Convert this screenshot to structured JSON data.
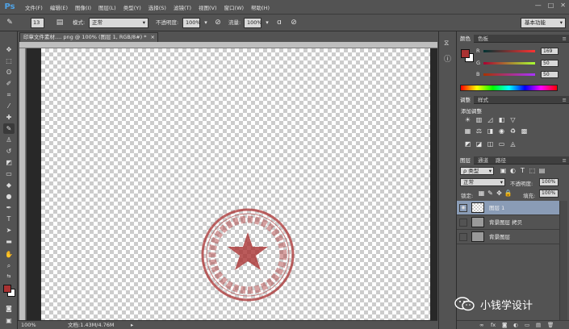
{
  "app": {
    "logo": "Ps"
  },
  "menu": [
    "文件(F)",
    "编辑(E)",
    "图像(I)",
    "图层(L)",
    "类型(Y)",
    "选择(S)",
    "滤镜(T)",
    "视图(V)",
    "窗口(W)",
    "帮助(H)"
  ],
  "options": {
    "brush_size": "13",
    "mode_label": "模式:",
    "mode_value": "正常",
    "opacity_label": "不透明度:",
    "opacity_value": "100%",
    "flow_label": "流量:",
    "flow_value": "100%",
    "workspace": "基本功能"
  },
  "document": {
    "tab_title": "印章文件素材.... png @ 100% (图层 1, RGB/8#) *",
    "zoom": "100%",
    "doc_info": "文档:1.43M/4.76M"
  },
  "color_panel": {
    "tabs": [
      "颜色",
      "色板"
    ],
    "channels": [
      {
        "label": "R",
        "value": "169"
      },
      {
        "label": "G",
        "value": "50"
      },
      {
        "label": "B",
        "value": "50"
      }
    ],
    "foreground": "#a93232",
    "background": "#ffffff"
  },
  "adjust_panel": {
    "tabs": [
      "调整",
      "样式"
    ],
    "title": "添加调整"
  },
  "layers_panel": {
    "tabs": [
      "图层",
      "通道",
      "路径"
    ],
    "filter_label": "ρ 类型",
    "blend_mode": "正常",
    "opacity_label": "不透明度:",
    "opacity_value": "100%",
    "lock_label": "锁定:",
    "fill_label": "填充:",
    "fill_value": "100%",
    "layers": [
      {
        "name": "图层 1",
        "selected": true,
        "visible": true
      },
      {
        "name": "背景图层 拷贝",
        "selected": false,
        "visible": false
      },
      {
        "name": "背景图层",
        "selected": false,
        "visible": false
      }
    ]
  },
  "watermark": {
    "text": "小钱学设计"
  },
  "colors": {
    "accent": "#4fa3e6",
    "selection": "#8a9cb6",
    "stamp": "#a93232"
  }
}
